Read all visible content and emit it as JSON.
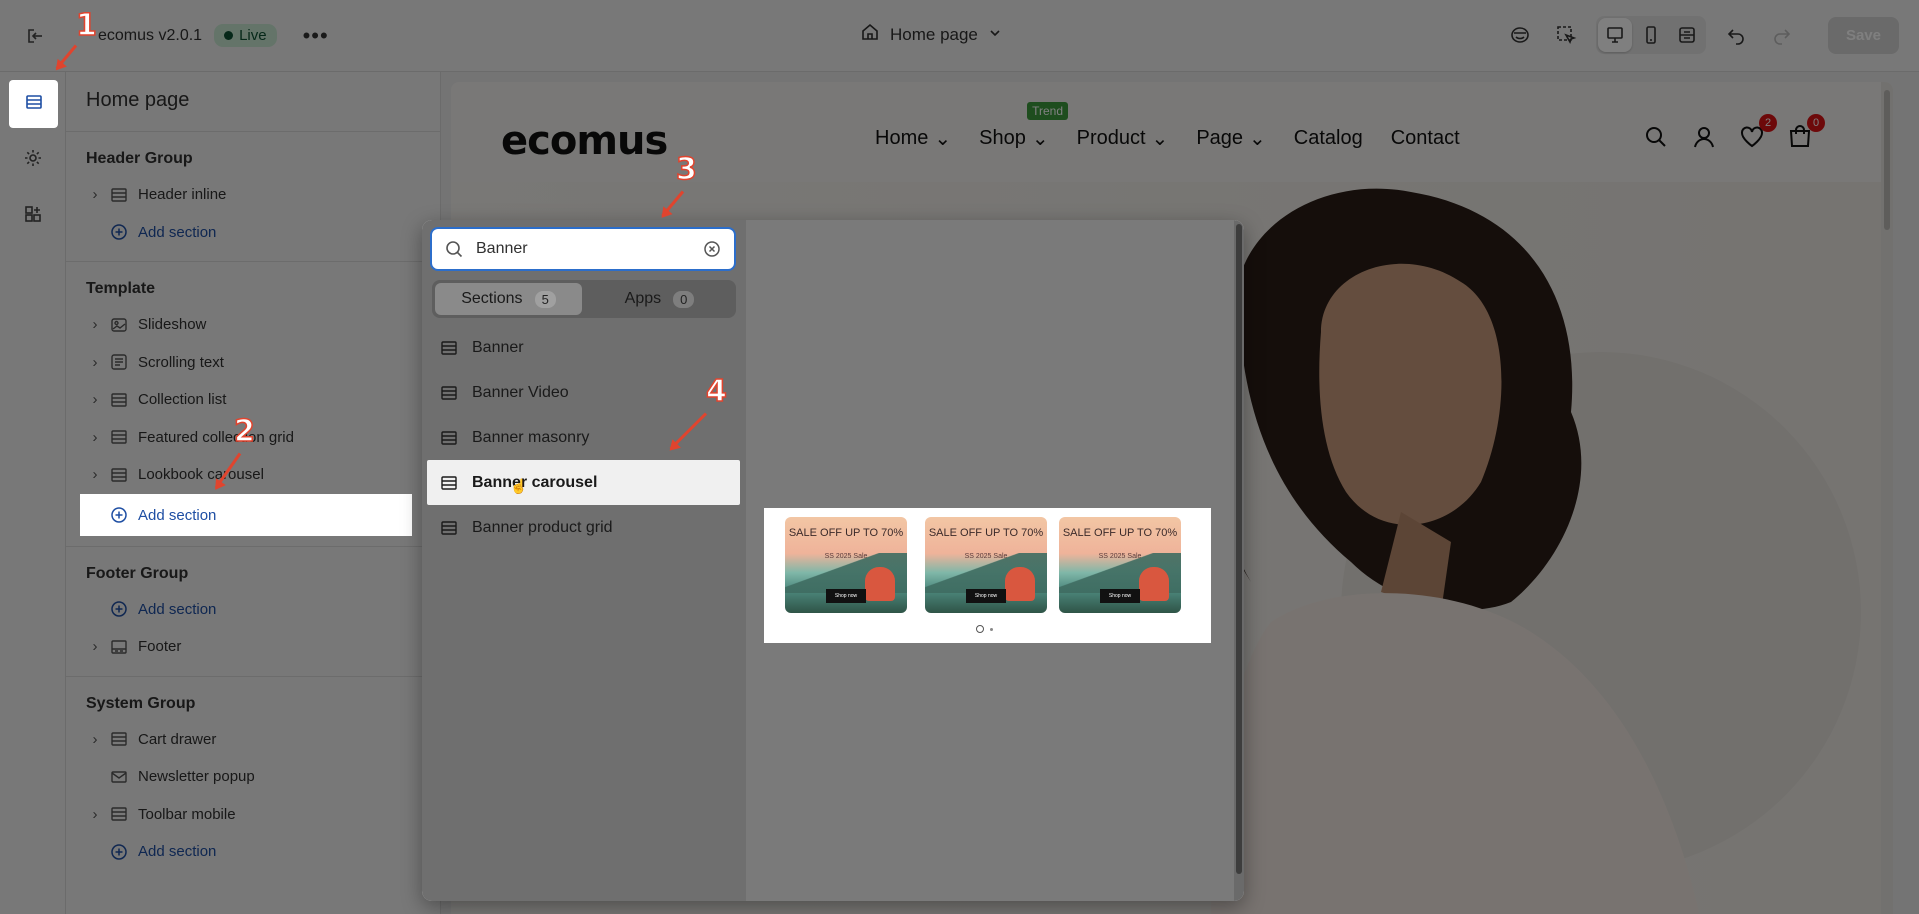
{
  "topbar": {
    "store_name": "ecomus v2.0.1",
    "live_label": "Live",
    "more_label": "•••",
    "page_selector": "Home page",
    "save_label": "Save"
  },
  "panel": {
    "title": "Home page",
    "groups": [
      {
        "title": "Header Group",
        "items": [
          "Header inline"
        ],
        "add_label": "Add section"
      },
      {
        "title": "Template",
        "items": [
          "Slideshow",
          "Scrolling text",
          "Collection list",
          "Featured collection grid",
          "Lookbook carousel"
        ],
        "add_label": "Add section"
      },
      {
        "title": "Footer Group",
        "items": [
          "Footer"
        ],
        "add_label": "Add section"
      },
      {
        "title": "System Group",
        "items": [
          "Cart drawer",
          "Newsletter popup",
          "Toolbar mobile"
        ],
        "add_label": "Add section"
      }
    ]
  },
  "store": {
    "logo": "ecomus",
    "nav": [
      "Home",
      "Shop",
      "Product",
      "Page",
      "Catalog",
      "Contact"
    ],
    "trend_badge": "Trend",
    "wishlist_count": "2",
    "cart_count": "0"
  },
  "picker": {
    "search_value": "Banner",
    "tabs": [
      {
        "label": "Sections",
        "count": "5"
      },
      {
        "label": "Apps",
        "count": "0"
      }
    ],
    "results": [
      "Banner",
      "Banner Video",
      "Banner masonry",
      "Banner carousel",
      "Banner product grid"
    ],
    "preview": {
      "tile_title": "SALE OFF UP TO 70%",
      "tile_sub": "SS 2025 Sale",
      "tile_button": "Shop now"
    }
  },
  "annotations": [
    "1",
    "2",
    "3",
    "4"
  ],
  "colors": {
    "accent": "#1e4ea3",
    "annotation": "#e0442e",
    "live_bg": "#c9e9d2",
    "trend": "#3d9a3c",
    "badge": "#db1215"
  }
}
